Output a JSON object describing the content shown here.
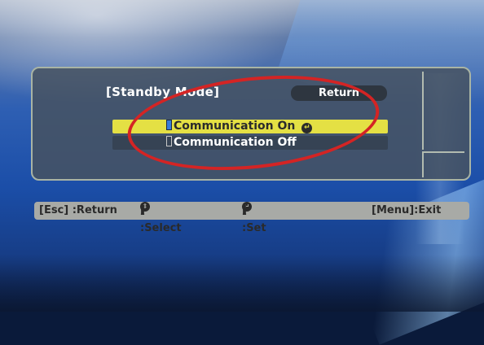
{
  "menu": {
    "title": "[Standby Mode]",
    "return_label": "Return",
    "options": [
      {
        "label": "Communication On",
        "selected": true
      },
      {
        "label": "Communication Off",
        "selected": false
      }
    ]
  },
  "help_bar": {
    "esc": "[Esc] :Return",
    "select_open": "[",
    "select_close": "] :Select",
    "set_open": "[",
    "set_close": "] :Set",
    "menu": "[Menu]:Exit"
  },
  "icons": {
    "select": "up-down-arrows-icon",
    "set": "enter-icon"
  },
  "colors": {
    "highlight": "#e4e044",
    "panel": "#46525f",
    "annotation": "#d42424",
    "help_bar": "#a8aaa6"
  }
}
